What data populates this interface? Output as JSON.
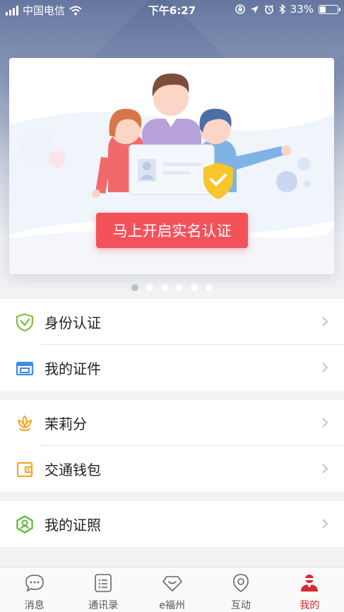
{
  "status_bar": {
    "carrier": "中国电信",
    "time": "下午6:27",
    "battery_percent": "33%",
    "battery_level": 0.33
  },
  "banner": {
    "cta_label": "马上开启实名认证",
    "page_count": 6,
    "active_page": 0
  },
  "menu_groups": [
    [
      {
        "label": "身份认证",
        "icon": "shield-check-icon",
        "color": "#7cc243"
      },
      {
        "label": "我的证件",
        "icon": "id-card-icon",
        "color": "#3f8ce0"
      }
    ],
    [
      {
        "label": "茉莉分",
        "icon": "jasmine-flower-icon",
        "color": "#f5a623"
      },
      {
        "label": "交通钱包",
        "icon": "wallet-icon",
        "color": "#f5a623"
      }
    ],
    [
      {
        "label": "我的证照",
        "icon": "license-badge-icon",
        "color": "#5cb531"
      }
    ]
  ],
  "tabs": [
    {
      "label": "消息",
      "icon": "chat-bubble-icon",
      "active": false
    },
    {
      "label": "通讯录",
      "icon": "contacts-list-icon",
      "active": false
    },
    {
      "label": "e福州",
      "icon": "diamond-smile-icon",
      "active": false
    },
    {
      "label": "互动",
      "icon": "location-pin-icon",
      "active": false
    },
    {
      "label": "我的",
      "icon": "user-profile-icon",
      "active": true
    }
  ],
  "colors": {
    "accent": "#d7282f",
    "cta": "#f4525a"
  }
}
